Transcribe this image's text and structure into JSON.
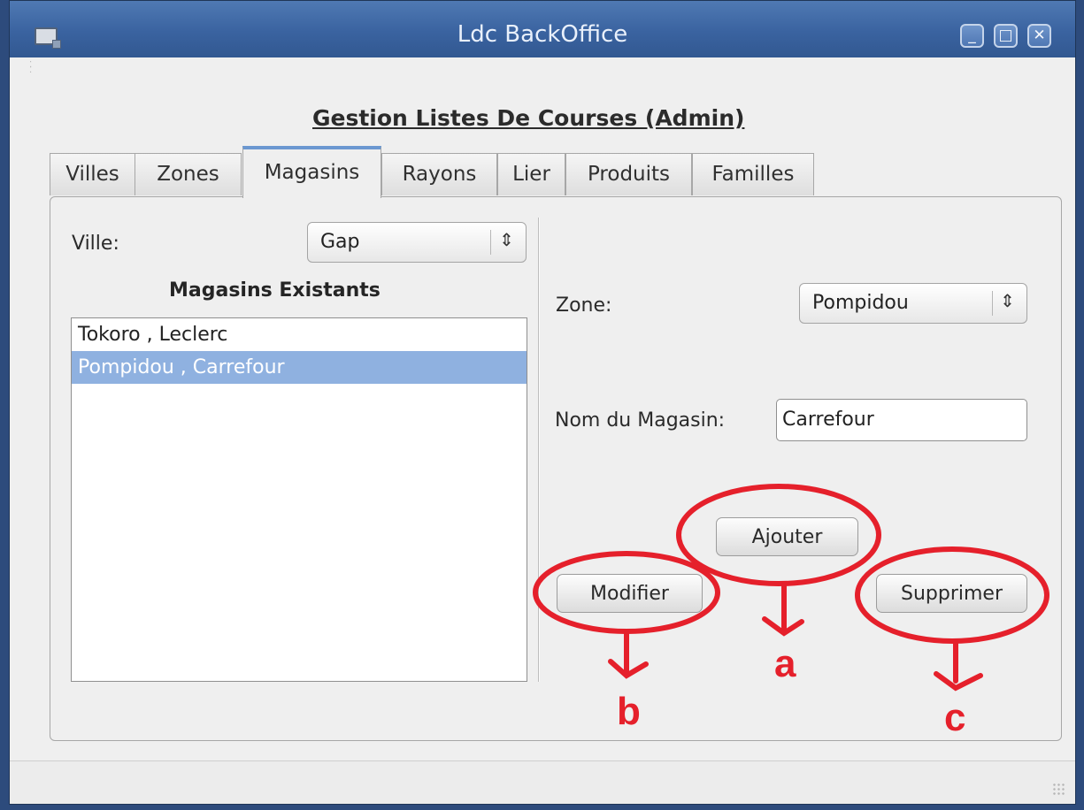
{
  "window": {
    "title": "Ldc BackOffice",
    "controls": {
      "minimize": "_",
      "maximize": "□",
      "close": "✕"
    }
  },
  "page_title": "Gestion Listes De Courses (Admin)",
  "tabs": [
    {
      "label": "Villes",
      "active": false
    },
    {
      "label": "Zones",
      "active": false
    },
    {
      "label": "Magasins",
      "active": true
    },
    {
      "label": "Rayons",
      "active": false
    },
    {
      "label": "Lier",
      "active": false
    },
    {
      "label": "Produits",
      "active": false
    },
    {
      "label": "Familles",
      "active": false
    }
  ],
  "left": {
    "ville_label": "Ville:",
    "ville_value": "Gap",
    "list_title": "Magasins Existants",
    "items": [
      {
        "text": "Tokoro , Leclerc",
        "selected": false
      },
      {
        "text": "Pompidou , Carrefour",
        "selected": true
      }
    ]
  },
  "right": {
    "zone_label": "Zone:",
    "zone_value": "Pompidou",
    "nom_label": "Nom du Magasin:",
    "nom_value": "Carrefour",
    "buttons": {
      "ajouter": "Ajouter",
      "modifier": "Modifier",
      "supprimer": "Supprimer"
    }
  },
  "annotations": {
    "a": "a",
    "b": "b",
    "c": "c",
    "color": "#e5202b"
  },
  "icons": {
    "combo_arrow": "⇕ up-down-arrows-icon",
    "window_icon": "window-icon"
  }
}
